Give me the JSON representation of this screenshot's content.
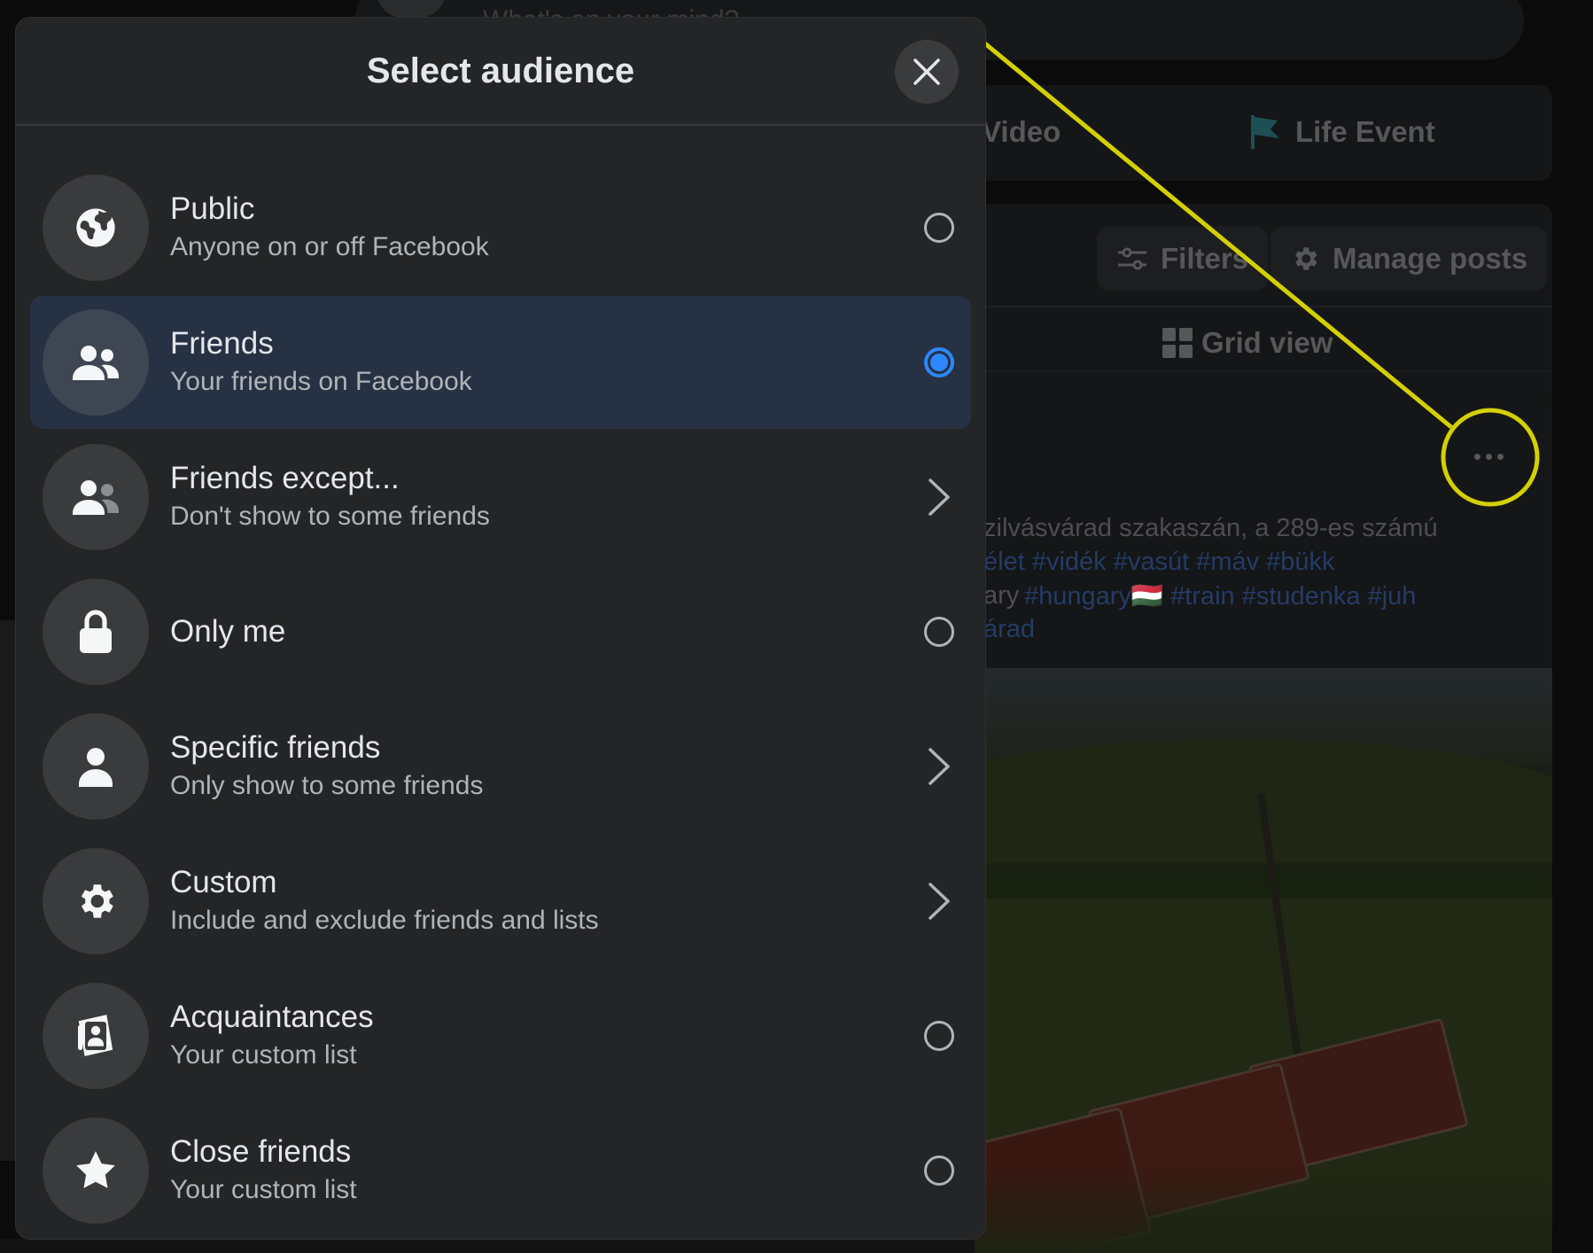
{
  "modal": {
    "title": "Select audience",
    "close_icon": "close-icon",
    "options": [
      {
        "icon": "globe-icon",
        "title": "Public",
        "subtitle": "Anyone on or off Facebook",
        "control": "radio",
        "selected": false
      },
      {
        "icon": "friends-icon",
        "title": "Friends",
        "subtitle": "Your friends on Facebook",
        "control": "radio",
        "selected": true
      },
      {
        "icon": "friends-except-icon",
        "title": "Friends except...",
        "subtitle": "Don't show to some friends",
        "control": "chevron",
        "selected": false
      },
      {
        "icon": "lock-icon",
        "title": "Only me",
        "subtitle": "",
        "control": "radio",
        "selected": false
      },
      {
        "icon": "person-icon",
        "title": "Specific friends",
        "subtitle": "Only show to some friends",
        "control": "chevron",
        "selected": false
      },
      {
        "icon": "gear-icon",
        "title": "Custom",
        "subtitle": "Include and exclude friends and lists",
        "control": "chevron",
        "selected": false
      },
      {
        "icon": "contact-card-icon",
        "title": "Acquaintances",
        "subtitle": "Your custom list",
        "control": "radio",
        "selected": false
      },
      {
        "icon": "star-icon",
        "title": "Close friends",
        "subtitle": "Your custom list",
        "control": "radio",
        "selected": false
      }
    ]
  },
  "background": {
    "composer_placeholder": "What's on your mind?",
    "video_label": "Video",
    "life_event_label": "Life Event",
    "filters_label": "Filters",
    "manage_posts_label": "Manage posts",
    "grid_view_label": "Grid view",
    "post_text_line1": "zilvásvárad szakaszán, a 289-es számú",
    "post_tags_line2": "élet #vidék #vasút #máv #bükk",
    "post_tags_line3_prefix": "ary",
    "post_tags_line3": "#hungary🇭🇺 #train #studenka #juh",
    "post_tags_line4": "árad"
  },
  "colors": {
    "accent": "#2d88ff",
    "annotation": "#d4d000",
    "modal_bg": "#242526",
    "selected_row": "#263143"
  }
}
